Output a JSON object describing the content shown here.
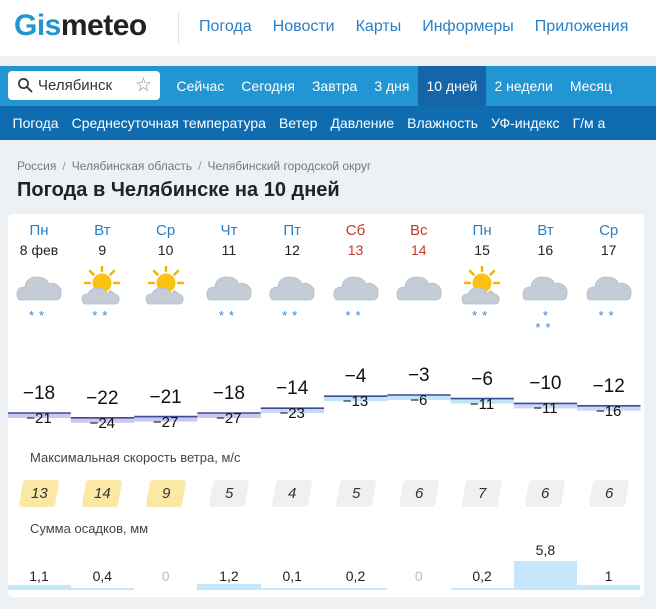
{
  "logo": {
    "part1": "Gis",
    "part2": "meteo"
  },
  "top_nav": [
    "Погода",
    "Новости",
    "Карты",
    "Информеры",
    "Приложения"
  ],
  "search": {
    "city": "Челябинск"
  },
  "period_tabs": [
    {
      "label": "Сейчас",
      "active": false
    },
    {
      "label": "Сегодня",
      "active": false
    },
    {
      "label": "Завтра",
      "active": false
    },
    {
      "label": "3 дня",
      "active": false
    },
    {
      "label": "10 дней",
      "active": true
    },
    {
      "label": "2 недели",
      "active": false
    },
    {
      "label": "Месяц",
      "active": false
    }
  ],
  "sub_tabs": [
    "Погода",
    "Среднесуточная температура",
    "Ветер",
    "Давление",
    "Влажность",
    "УФ-индекс",
    "Г/м а"
  ],
  "breadcrumb": [
    "Россия",
    "Челябинская область",
    "Челябинский городской округ"
  ],
  "page_title": "Погода в Челябинске на 10 дней",
  "colors": {
    "accent": "#2196d3",
    "accent_dark": "#0f6cb0",
    "active_tab": "#1565a8",
    "weekend": "#c0392b"
  },
  "forecast": {
    "days": [
      {
        "name": "Пн",
        "date": "8 фев",
        "weekend": false,
        "icon": "cloud-snow-icon",
        "snow": "**",
        "max": "−18",
        "min": "−21",
        "wind": "13",
        "wind_level": "moderate",
        "precip": "1,1",
        "precip_mm": 1.1
      },
      {
        "name": "Вт",
        "date": "9",
        "weekend": false,
        "icon": "sun-cloud-snow-icon",
        "snow": "**",
        "max": "−22",
        "min": "−24",
        "wind": "14",
        "wind_level": "moderate",
        "precip": "0,4",
        "precip_mm": 0.4
      },
      {
        "name": "Ср",
        "date": "10",
        "weekend": false,
        "icon": "sun-cloud-icon",
        "snow": "",
        "max": "−21",
        "min": "−27",
        "wind": "9",
        "wind_level": "moderate",
        "precip": "0",
        "precip_mm": 0
      },
      {
        "name": "Чт",
        "date": "11",
        "weekend": false,
        "icon": "cloud-snow-icon",
        "snow": "**",
        "max": "−18",
        "min": "−27",
        "wind": "5",
        "wind_level": "low",
        "precip": "1,2",
        "precip_mm": 1.2
      },
      {
        "name": "Пт",
        "date": "12",
        "weekend": false,
        "icon": "cloud-snow-icon",
        "snow": "**",
        "max": "−14",
        "min": "−23",
        "wind": "4",
        "wind_level": "low",
        "precip": "0,1",
        "precip_mm": 0.1
      },
      {
        "name": "Сб",
        "date": "13",
        "weekend": true,
        "icon": "cloud-snow-icon",
        "snow": "**",
        "max": "−4",
        "min": "−13",
        "wind": "5",
        "wind_level": "low",
        "precip": "0,2",
        "precip_mm": 0.2
      },
      {
        "name": "Вс",
        "date": "14",
        "weekend": true,
        "icon": "cloud-icon",
        "snow": "",
        "max": "−3",
        "min": "−6",
        "wind": "6",
        "wind_level": "low",
        "precip": "0",
        "precip_mm": 0
      },
      {
        "name": "Пн",
        "date": "15",
        "weekend": false,
        "icon": "sun-cloud-snow-icon",
        "snow": "**",
        "max": "−6",
        "min": "−11",
        "wind": "7",
        "wind_level": "low",
        "precip": "0,2",
        "precip_mm": 0.2
      },
      {
        "name": "Вт",
        "date": "16",
        "weekend": false,
        "icon": "cloud-heavy-snow-icon",
        "snow": "***",
        "max": "−10",
        "min": "−11",
        "wind": "6",
        "wind_level": "low",
        "precip": "5,8",
        "precip_mm": 5.8
      },
      {
        "name": "Ср",
        "date": "17",
        "weekend": false,
        "icon": "cloud-snow-icon",
        "snow": "**",
        "max": "−12",
        "min": "−16",
        "wind": "6",
        "wind_level": "low",
        "precip": "1",
        "precip_mm": 1.0
      }
    ],
    "wind_title": "Максимальная скорость ветра, м/с",
    "precip_title": "Сумма осадков, мм"
  }
}
